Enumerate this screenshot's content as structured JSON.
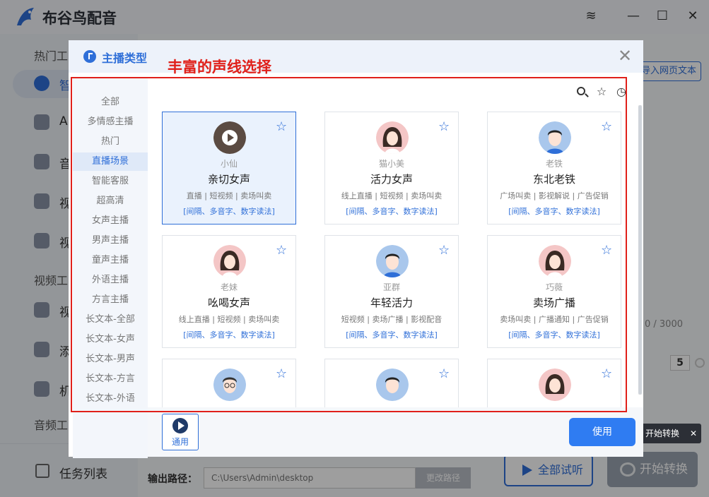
{
  "app": {
    "title": "布谷鸟配音",
    "brand_color": "#2f6fd8"
  },
  "window_controls": [
    "layers",
    "minimize",
    "maximize",
    "close"
  ],
  "sidebar": {
    "section_1": "热门工",
    "items_1": [
      {
        "label": "智",
        "icon": "smart-icon",
        "active": true
      },
      {
        "label": "A",
        "icon": "ai-icon"
      },
      {
        "label": "音",
        "icon": "audio-icon"
      },
      {
        "label": "视",
        "icon": "video-icon"
      },
      {
        "label": "视",
        "icon": "video-voice-icon"
      }
    ],
    "section_2": "视频工",
    "items_2": [
      {
        "label": "视",
        "icon": "video-edit-icon"
      },
      {
        "label": "添",
        "icon": "add-icon"
      },
      {
        "label": "机",
        "icon": "robot-icon"
      }
    ],
    "section_3": "音频工",
    "task_list": "任务列表"
  },
  "background": {
    "import_button": "导入网页文本",
    "char_count": "0 / 3000",
    "speed_value": "5",
    "tooltip": "开始转换",
    "output_label": "输出路径：",
    "output_path": "C:\\Users\\Admin\\desktop",
    "change_path": "更改路径",
    "trial_all": "全部试听",
    "start_convert": "开始转换"
  },
  "modal": {
    "title": "主播类型",
    "annotation": "丰富的声线选择",
    "categories": [
      "全部",
      "多情感主播",
      "热门",
      "直播场景",
      "智能客服",
      "超高清",
      "女声主播",
      "男声主播",
      "童声主播",
      "外语主播",
      "方言主播",
      "长文本-全部",
      "长文本-女声",
      "长文本-男声",
      "长文本-方言",
      "长文本-外语"
    ],
    "active_category": "直播场景",
    "toolbar_icons": [
      "search-icon",
      "star-icon",
      "history-icon"
    ],
    "voices": [
      {
        "name": "小仙",
        "style": "亲切女声",
        "tags": "直播 | 短视频 | 卖场叫卖",
        "features": "[间隔、多音字、数字读法]",
        "avatar": "playing",
        "selected": true
      },
      {
        "name": "猫小美",
        "style": "活力女声",
        "tags": "线上直播 | 短视频 | 卖场叫卖",
        "features": "[间隔、多音字、数字读法]",
        "avatar": "female"
      },
      {
        "name": "老铁",
        "style": "东北老铁",
        "tags": "广场叫卖 | 影视解说 | 广告促销",
        "features": "[间隔、多音字、数字读法]",
        "avatar": "male"
      },
      {
        "name": "老妹",
        "style": "吆喝女声",
        "tags": "线上直播 | 短视频 | 卖场叫卖",
        "features": "[间隔、多音字、数字读法]",
        "avatar": "female"
      },
      {
        "name": "亚群",
        "style": "年轻活力",
        "tags": "短视频 | 卖场广播 | 影视配音",
        "features": "[间隔、多音字、数字读法]",
        "avatar": "male"
      },
      {
        "name": "巧薇",
        "style": "卖场广播",
        "tags": "卖场叫卖 | 广播通知 | 广告促销",
        "features": "[间隔、多音字、数字读法]",
        "avatar": "female"
      },
      {
        "name": "",
        "style": "",
        "tags": "",
        "features": "",
        "avatar": "male-glasses"
      },
      {
        "name": "",
        "style": "",
        "tags": "",
        "features": "",
        "avatar": "male"
      },
      {
        "name": "",
        "style": "",
        "tags": "",
        "features": "",
        "avatar": "female"
      }
    ],
    "general_button": "通用",
    "use_button": "使用"
  }
}
